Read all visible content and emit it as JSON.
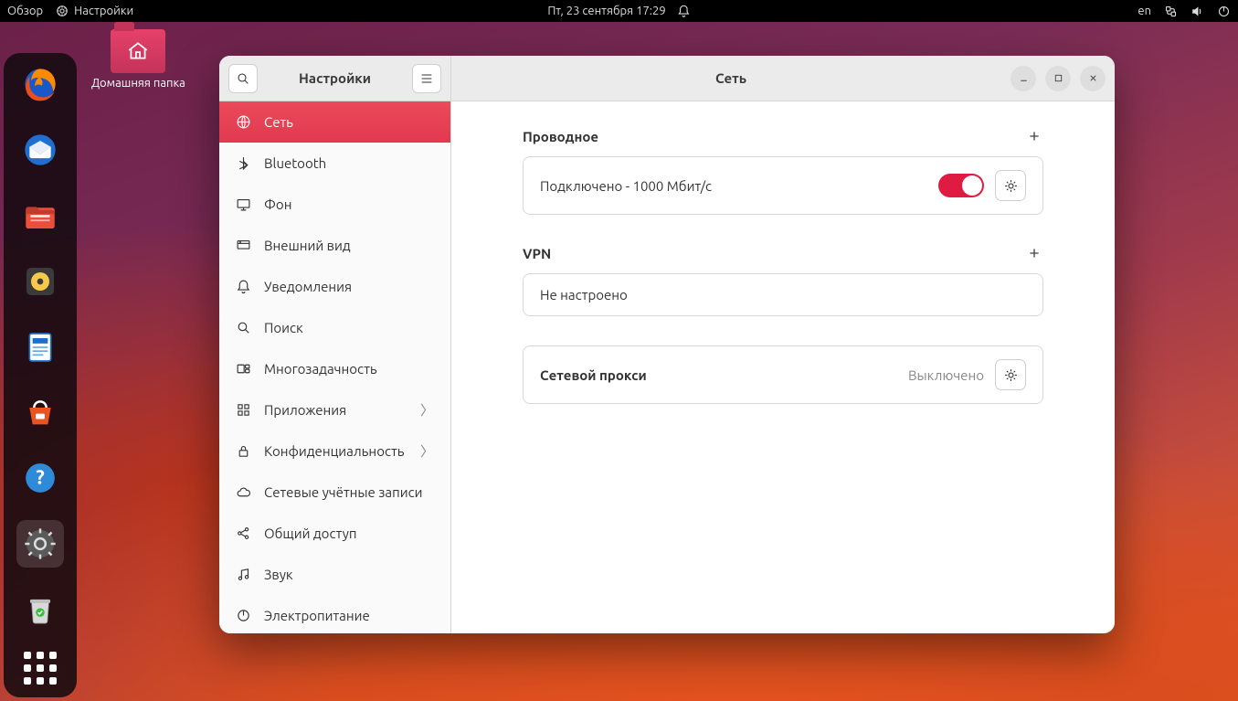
{
  "topbar": {
    "overview": "Обзор",
    "appname": "Настройки",
    "datetime": "Пт, 23 сентября  17:29",
    "lang": "en"
  },
  "desktop": {
    "home_label": "Домашняя папка"
  },
  "window": {
    "sidebar_title": "Настройки",
    "content_title": "Сеть"
  },
  "sidebar": {
    "items": [
      {
        "label": "Сеть"
      },
      {
        "label": "Bluetooth"
      },
      {
        "label": "Фон"
      },
      {
        "label": "Внешний вид"
      },
      {
        "label": "Уведомления"
      },
      {
        "label": "Поиск"
      },
      {
        "label": "Многозадачность"
      },
      {
        "label": "Приложения"
      },
      {
        "label": "Конфиденциальность"
      },
      {
        "label": "Сетевые учётные записи"
      },
      {
        "label": "Общий доступ"
      },
      {
        "label": "Звук"
      },
      {
        "label": "Электропитание"
      }
    ]
  },
  "network": {
    "wired_heading": "Проводное",
    "wired_status": "Подключено - 1000 Мбит/с",
    "vpn_heading": "VPN",
    "vpn_status": "Не настроено",
    "proxy_heading": "Сетевой прокси",
    "proxy_status": "Выключено"
  }
}
